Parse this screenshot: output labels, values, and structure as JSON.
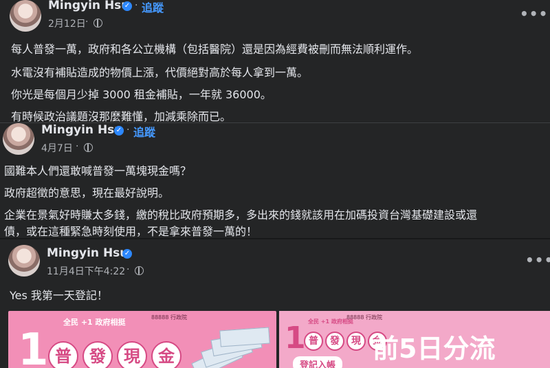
{
  "posts": [
    {
      "author": "Mingyin Hsu",
      "follow": "追蹤",
      "separator": "·",
      "date": "2月12日",
      "lines": [
        "每人普發一萬，政府和各公立機構（包括醫院）還是因為經費被刪而無法順利運作。",
        "水電沒有補貼造成的物價上漲，代價絕對高於每人拿到一萬。",
        "你光是每個月少掉 3000 租金補貼，一年就 36000。",
        "有時候政治議題沒那麼難懂，加減乘除而已。"
      ]
    },
    {
      "author": "Mingyin Hsu",
      "follow": "追蹤",
      "separator": "·",
      "date": "4月7日",
      "lines": [
        "國難本人們還敢喊普發一萬塊現金嗎？",
        "政府超徵的意思，現在最好說明。",
        "企業在景氣好時賺太多錢，繳的稅比政府預期多，多出來的錢就該用在加碼投資台灣基礎建設或還",
        "債，或在這種緊急時刻使用，不是拿來普發一萬的！"
      ]
    },
    {
      "author": "Mingyin Hsu",
      "date": "11月4日下午4:22",
      "separator": "·",
      "lines": [
        "Yes 我第一天登記！"
      ],
      "banner": {
        "left_tag": "全民 +1 政府相挺",
        "left_logo": "88888 行政院",
        "one": "1",
        "circles": [
          "普",
          "發",
          "現",
          "金"
        ],
        "right_tag": "全民 +1 政府相挺",
        "right_logo": "88888 行政院",
        "headline": "前5日分流",
        "pill": "登記入帳"
      }
    }
  ],
  "colors": {
    "background": "#18191a",
    "card": "#242526",
    "text": "#e4e6eb",
    "muted": "#b0b3b8",
    "link": "#4599ff",
    "verified": "#2d88ff",
    "banner_pink": "#f28fb7"
  },
  "icons": {
    "verified": "verified-badge-icon",
    "audience": "globe-icon",
    "menu": "more-options-icon"
  },
  "symbols": {
    "more": "•••",
    "check": "✓"
  }
}
